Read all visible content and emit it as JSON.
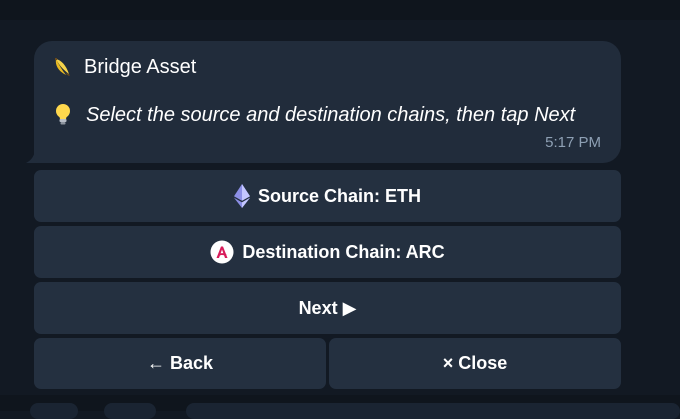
{
  "message": {
    "title": "Bridge Asset",
    "body": "Select the source and destination chains, then tap Next",
    "time": "5:17 PM"
  },
  "keyboard": {
    "source": "Source Chain: ETH",
    "destination": "Destination Chain: ARC",
    "next": "Next ▶",
    "back": "← Back",
    "close": "× Close"
  },
  "icons": {
    "title": "banana-icon",
    "hint": "lightbulb-icon",
    "source": "ethereum-icon",
    "destination": "arc-icon"
  },
  "colors": {
    "bubble": "#212c3b",
    "button": "#243040",
    "background": "#121923",
    "time": "#8ea0b4"
  }
}
